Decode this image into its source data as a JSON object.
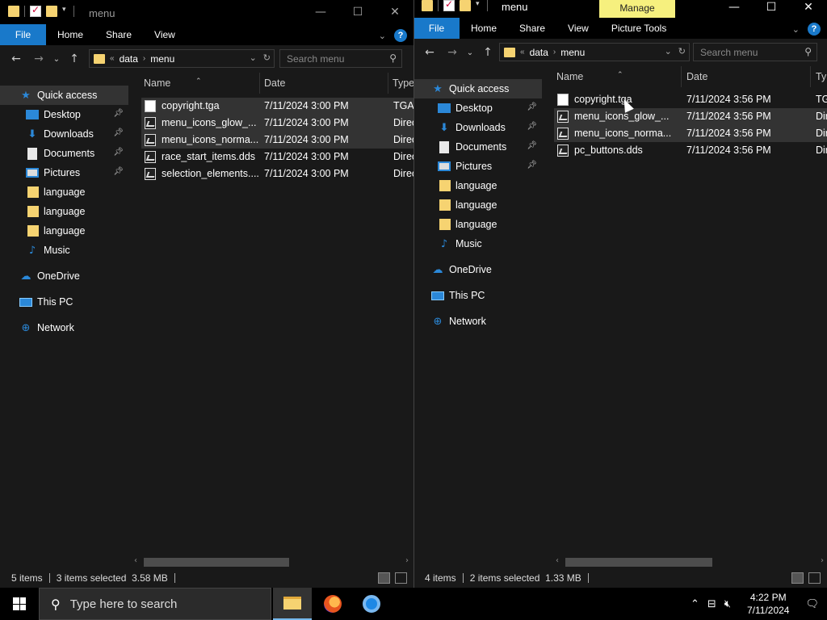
{
  "left_window": {
    "title": "menu",
    "ribbon_tabs": [
      "File",
      "Home",
      "Share",
      "View"
    ],
    "breadcrumb": [
      "data",
      "menu"
    ],
    "search_placeholder": "Search menu",
    "columns": [
      "Name",
      "Date",
      "Type"
    ],
    "nav_items": [
      {
        "label": "Quick access",
        "icon": "star-icon",
        "pinned": false
      },
      {
        "label": "Desktop",
        "icon": "desktop-icon",
        "pinned": true
      },
      {
        "label": "Downloads",
        "icon": "download-icon",
        "pinned": true
      },
      {
        "label": "Documents",
        "icon": "documents-icon",
        "pinned": true
      },
      {
        "label": "Pictures",
        "icon": "pictures-icon",
        "pinned": true
      },
      {
        "label": "language",
        "icon": "folder-icon",
        "pinned": false
      },
      {
        "label": "language",
        "icon": "folder-icon",
        "pinned": false
      },
      {
        "label": "language",
        "icon": "folder-icon",
        "pinned": false
      },
      {
        "label": "Music",
        "icon": "music-icon",
        "pinned": false
      },
      {
        "label": "OneDrive",
        "icon": "onedrive-icon",
        "pinned": false
      },
      {
        "label": "This PC",
        "icon": "this-pc-icon",
        "pinned": false
      },
      {
        "label": "Network",
        "icon": "network-icon",
        "pinned": false
      }
    ],
    "files": [
      {
        "name": "copyright.tga",
        "date": "7/11/2024 3:00 PM",
        "type": "TGA",
        "icon": "blank-file-icon",
        "selected": true
      },
      {
        "name": "menu_icons_glow_...",
        "date": "7/11/2024 3:00 PM",
        "type": "Direc",
        "icon": "image-file-icon",
        "selected": true
      },
      {
        "name": "menu_icons_norma...",
        "date": "7/11/2024 3:00 PM",
        "type": "Direc",
        "icon": "image-file-icon",
        "selected": true
      },
      {
        "name": "race_start_items.dds",
        "date": "7/11/2024 3:00 PM",
        "type": "Direc",
        "icon": "image-file-icon",
        "selected": false
      },
      {
        "name": "selection_elements....",
        "date": "7/11/2024 3:00 PM",
        "type": "Direc",
        "icon": "image-file-icon",
        "selected": false
      }
    ],
    "status": {
      "count": "5 items",
      "selected": "3 items selected  3.58 MB"
    }
  },
  "right_window": {
    "title": "menu",
    "contextual_tab": "Manage",
    "ribbon_tabs": [
      "File",
      "Home",
      "Share",
      "View",
      "Picture Tools"
    ],
    "breadcrumb": [
      "data",
      "menu"
    ],
    "search_placeholder": "Search menu",
    "columns": [
      "Name",
      "Date",
      "Type"
    ],
    "nav_items": [
      {
        "label": "Quick access",
        "icon": "star-icon",
        "pinned": false
      },
      {
        "label": "Desktop",
        "icon": "desktop-icon",
        "pinned": true
      },
      {
        "label": "Downloads",
        "icon": "download-icon",
        "pinned": true
      },
      {
        "label": "Documents",
        "icon": "documents-icon",
        "pinned": true
      },
      {
        "label": "Pictures",
        "icon": "pictures-icon",
        "pinned": true
      },
      {
        "label": "language",
        "icon": "folder-icon",
        "pinned": false
      },
      {
        "label": "language",
        "icon": "folder-icon",
        "pinned": false
      },
      {
        "label": "language",
        "icon": "folder-icon",
        "pinned": false
      },
      {
        "label": "Music",
        "icon": "music-icon",
        "pinned": false
      },
      {
        "label": "OneDrive",
        "icon": "onedrive-icon",
        "pinned": false
      },
      {
        "label": "This PC",
        "icon": "this-pc-icon",
        "pinned": false
      },
      {
        "label": "Network",
        "icon": "network-icon",
        "pinned": false
      }
    ],
    "files": [
      {
        "name": "copyright.tga",
        "date": "7/11/2024 3:56 PM",
        "type": "TGA F",
        "icon": "blank-file-icon",
        "selected": false
      },
      {
        "name": "menu_icons_glow_...",
        "date": "7/11/2024 3:56 PM",
        "type": "Direc",
        "icon": "image-file-icon",
        "selected": true
      },
      {
        "name": "menu_icons_norma...",
        "date": "7/11/2024 3:56 PM",
        "type": "Direc",
        "icon": "image-file-icon",
        "selected": true
      },
      {
        "name": "pc_buttons.dds",
        "date": "7/11/2024 3:56 PM",
        "type": "Direc",
        "icon": "image-file-icon",
        "selected": false
      }
    ],
    "status": {
      "count": "4 items",
      "selected": "2 items selected  1.33 MB"
    }
  },
  "taskbar": {
    "search_placeholder": "Type here to search",
    "apps": [
      "file-explorer",
      "firefox",
      "chromium"
    ],
    "time": "4:22 PM",
    "date": "7/11/2024"
  },
  "colors": {
    "accent": "#1979ca",
    "manage_tab": "#f6f07e",
    "folder": "#f6d371",
    "selection": "#333333"
  }
}
